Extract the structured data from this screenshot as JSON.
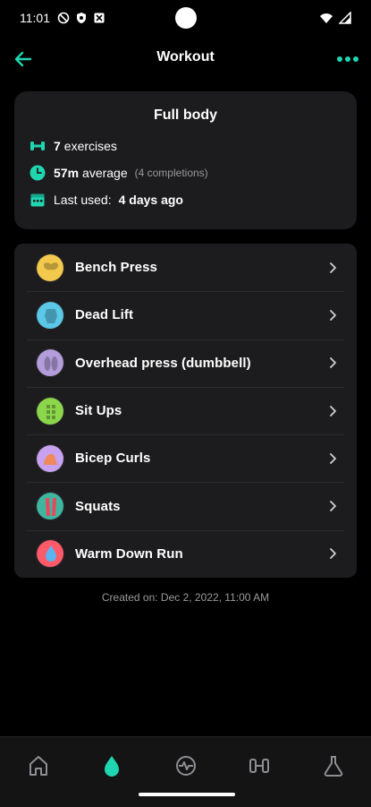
{
  "status_bar": {
    "time": "11:01",
    "left_icons": [
      "do-not-disturb-icon",
      "shield-icon",
      "notification-icon"
    ],
    "right_icons": [
      "wifi-icon",
      "signal-icon"
    ]
  },
  "app_bar": {
    "title": "Workout",
    "back_icon": "arrow-left-icon",
    "more_icon": "more-horizontal-icon"
  },
  "summary": {
    "title": "Full body",
    "exercises_count": "7",
    "exercises_label": "exercises",
    "average_time": "57m",
    "average_label": "average",
    "completions": "(4 completions)",
    "last_used_label": "Last used:",
    "last_used_value": "4 days ago"
  },
  "exercises": [
    {
      "label": "Bench Press",
      "icon": "chest-icon",
      "color": "#f2c94c"
    },
    {
      "label": "Dead Lift",
      "icon": "back-icon",
      "color": "#5bc8e8"
    },
    {
      "label": "Overhead press (dumbbell)",
      "icon": "shoulders-icon",
      "color": "#b39ddb"
    },
    {
      "label": "Sit Ups",
      "icon": "abs-icon",
      "color": "#8bd64b"
    },
    {
      "label": "Bicep Curls",
      "icon": "biceps-icon",
      "color": "#c7a2f0"
    },
    {
      "label": "Squats",
      "icon": "legs-icon",
      "color": "#3fb6a0"
    },
    {
      "label": "Warm Down Run",
      "icon": "cardio-drop-icon",
      "color": "#ff5a6a"
    }
  ],
  "created_on": "Created on: Dec 2, 2022, 11:00 AM",
  "bottom_nav": [
    {
      "icon": "home-icon",
      "active": false
    },
    {
      "icon": "workout-drop-icon",
      "active": true
    },
    {
      "icon": "activity-icon",
      "active": false
    },
    {
      "icon": "dumbbell-icon",
      "active": false
    },
    {
      "icon": "flask-icon",
      "active": false
    }
  ],
  "colors": {
    "accent": "#1fd6b0",
    "card": "#1c1c1e",
    "muted": "#9a9a9a"
  }
}
